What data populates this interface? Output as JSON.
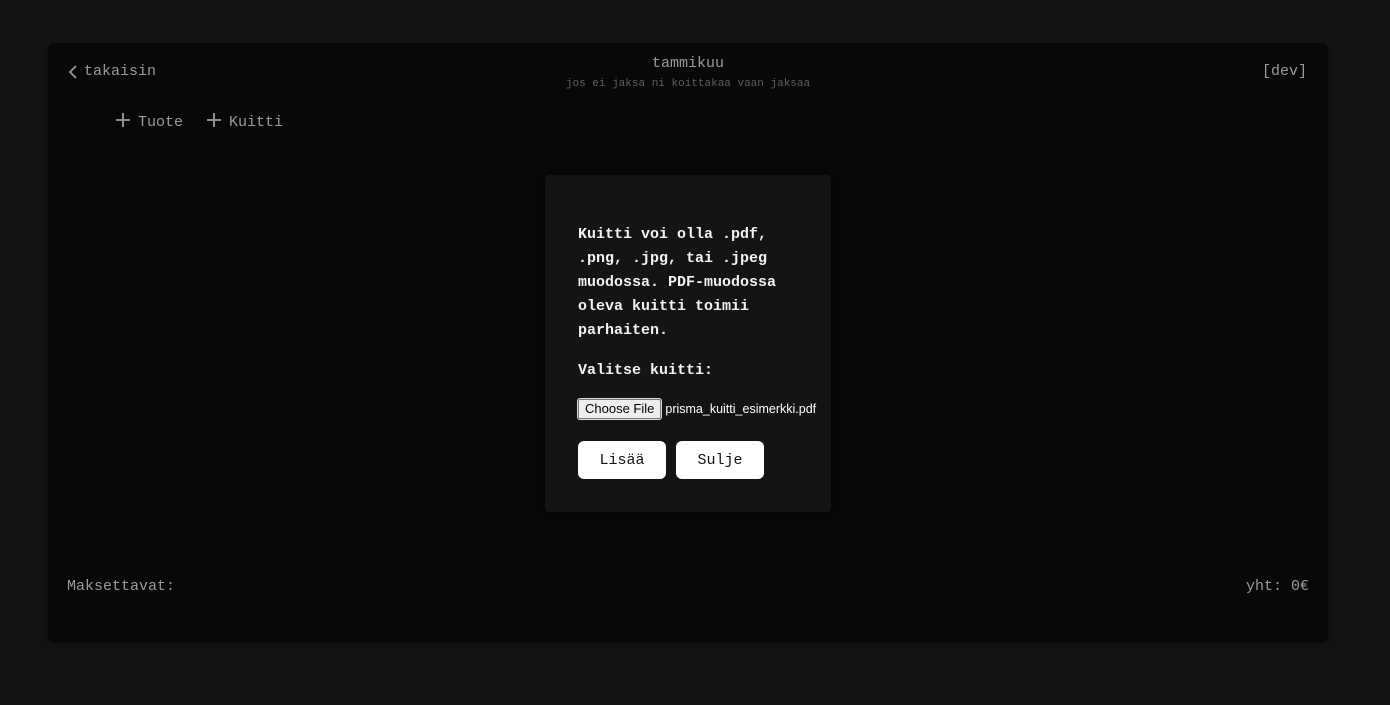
{
  "header": {
    "back_label": "takaisin",
    "title": "tammikuu",
    "subtitle": "jos ei jaksa ni koittakaa vaan jaksaa",
    "env_tag": "[dev]"
  },
  "actions": [
    {
      "label": "Tuote",
      "icon": "plus-icon"
    },
    {
      "label": "Kuitti",
      "icon": "plus-icon"
    }
  ],
  "footer": {
    "payables_label": "Maksettavat:",
    "total_label": "yht: 0€"
  },
  "modal": {
    "info_text": "Kuitti voi olla .pdf, .png, .jpg, tai .jpeg muodossa. PDF-muodossa oleva kuitti toimii parhaiten.",
    "select_label": "Valitse kuitti:",
    "file_button_label": "Choose File",
    "file_name": "prisma_kuitti_esimerkki.pdf",
    "add_label": "Lisää",
    "close_label": "Sulje"
  },
  "colors": {
    "page_bg": "#141414",
    "panel_bg": "#080808",
    "modal_bg": "#141414",
    "muted_text": "#9a9a9a",
    "button_bg": "#ffffff"
  }
}
